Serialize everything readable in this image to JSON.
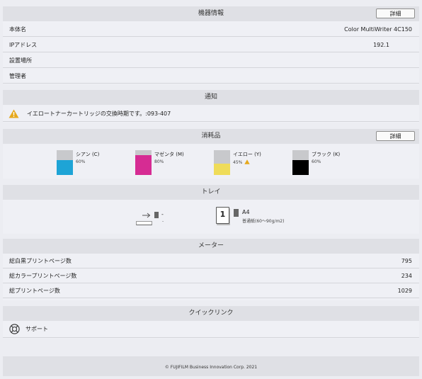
{
  "device_info": {
    "header": "機器情報",
    "detail_button": "詳細",
    "rows": [
      {
        "label": "本体名",
        "value": "Color MultiWriter 4C150"
      },
      {
        "label": "IPアドレス",
        "value": "192.1"
      },
      {
        "label": "設置場所",
        "value": ""
      },
      {
        "label": "管理者",
        "value": ""
      }
    ]
  },
  "notifications": {
    "header": "通知",
    "items": [
      {
        "icon": "warning-icon",
        "text": "イエロートナーカートリッジの交換時期です。:093-407",
        "color": "#e6a81c"
      }
    ]
  },
  "consumables": {
    "header": "消耗品",
    "detail_button": "詳細",
    "items": [
      {
        "name": "シアン (C)",
        "percent": "60%",
        "level": 0.6,
        "color": "#1ea4d6",
        "warning": false
      },
      {
        "name": "マゼンタ (M)",
        "percent": "80%",
        "level": 0.8,
        "color": "#d62c93",
        "warning": false
      },
      {
        "name": "イエロー (Y)",
        "percent": "45%",
        "level": 0.45,
        "color": "#efdc59",
        "warning": true
      },
      {
        "name": "ブラック (K)",
        "percent": "60%",
        "level": 0.6,
        "color": "#000000",
        "warning": false
      }
    ]
  },
  "trays": {
    "header": "トレイ",
    "items": [
      {
        "icon": "bypass-tray-icon",
        "size": "-",
        "paper": "-"
      },
      {
        "icon": "tray-1-icon",
        "number": "1",
        "size": "A4",
        "paper": "普通紙(60～90g/m2)"
      }
    ]
  },
  "meters": {
    "header": "メーター",
    "rows": [
      {
        "label": "総白黒プリントページ数",
        "value": "795"
      },
      {
        "label": "総カラープリントページ数",
        "value": "234"
      },
      {
        "label": "総プリントページ数",
        "value": "1029"
      }
    ]
  },
  "quick_links": {
    "header": "クイックリンク",
    "items": [
      {
        "icon": "lifebuoy-icon",
        "label": "サポート"
      }
    ]
  },
  "footer": {
    "copyright": "© FUJIFILM Business Innovation Corp. 2021"
  }
}
